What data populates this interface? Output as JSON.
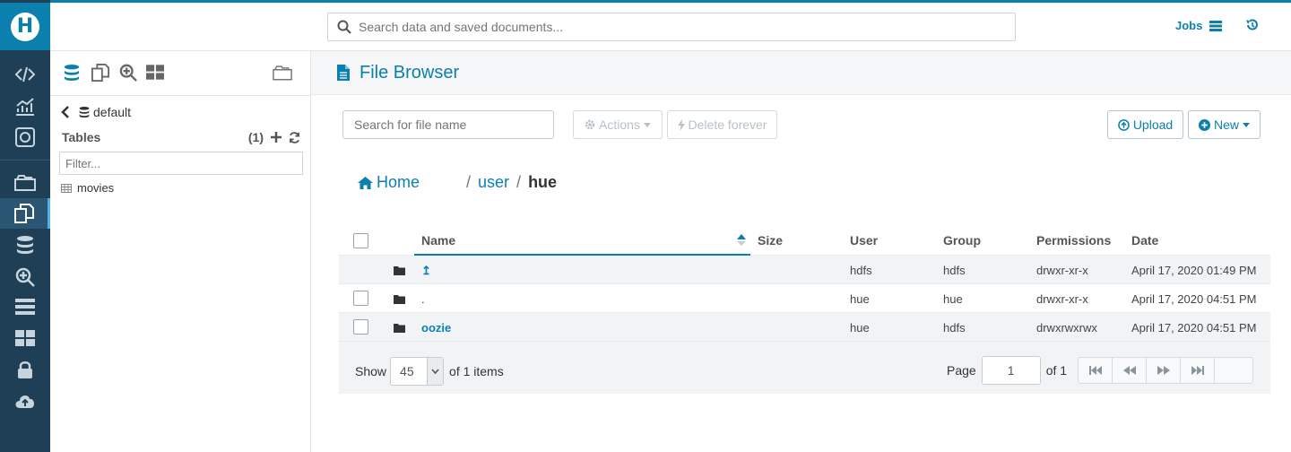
{
  "header": {
    "search_placeholder": "Search data and saved documents...",
    "jobs_label": "Jobs"
  },
  "assist": {
    "database": "default",
    "tables_label": "Tables",
    "tables_count": "(1)",
    "filter_placeholder": "Filter...",
    "tables": [
      "movies"
    ]
  },
  "main": {
    "title": "File Browser",
    "file_search_placeholder": "Search for file name",
    "actions_label": "Actions",
    "delete_label": "Delete forever",
    "upload_label": "Upload",
    "new_label": "New",
    "breadcrumb": {
      "home": "Home",
      "sep": "/",
      "path1": "user",
      "path2": "hue"
    },
    "columns": {
      "name": "Name",
      "size": "Size",
      "user": "User",
      "group": "Group",
      "permissions": "Permissions",
      "date": "Date"
    },
    "rows": [
      {
        "name": "↥",
        "size": "",
        "user": "hdfs",
        "group": "hdfs",
        "permissions": "drwxr-xr-x",
        "date": "April 17, 2020 01:49 PM"
      },
      {
        "name": ".",
        "size": "",
        "user": "hue",
        "group": "hue",
        "permissions": "drwxr-xr-x",
        "date": "April 17, 2020 04:51 PM"
      },
      {
        "name": "oozie",
        "size": "",
        "user": "hue",
        "group": "hdfs",
        "permissions": "drwxrwxrwx",
        "date": "April 17, 2020 04:51 PM"
      }
    ],
    "footer": {
      "show_label": "Show",
      "page_size": "45",
      "items_label": "of 1 items",
      "page_label": "Page",
      "page_value": "1",
      "of_pages": "of 1"
    }
  },
  "colors": {
    "accent": "#0b7fad",
    "rail": "#1e3f55",
    "rail_active": "#2a5673"
  }
}
